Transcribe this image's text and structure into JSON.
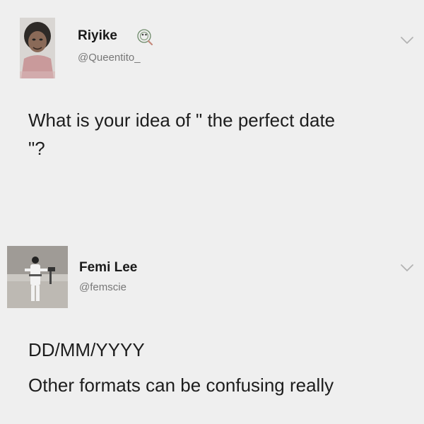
{
  "tweets": [
    {
      "author": {
        "display_name": "Riyike",
        "handle": "@Queentito_",
        "verified_icon": "emoji-badge-icon"
      },
      "text_lines": [
        "What is your idea of \" the perfect date",
        "\"?"
      ]
    },
    {
      "author": {
        "display_name": "Femi Lee",
        "handle": "@femscie"
      },
      "text_lines": [
        "DD/MM/YYYY",
        "Other formats can be confusing really"
      ]
    }
  ],
  "colors": {
    "background": "#efefef",
    "text": "#1c1c1c",
    "handle": "#777777"
  }
}
